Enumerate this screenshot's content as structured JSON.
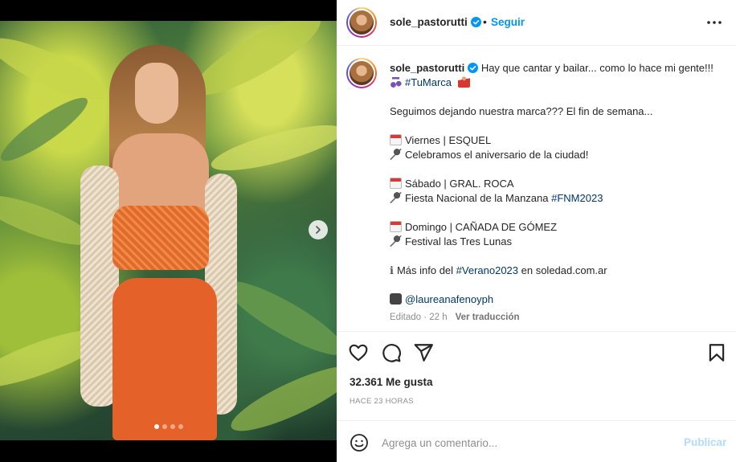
{
  "post": {
    "username": "sole_pastorutti",
    "follow_label": "Seguir",
    "follow_separator": "•",
    "caption": {
      "line1_text": "Hay que cantar y bailar... como lo hace mi gente!!! ",
      "line1_tag": "#TuMarca",
      "line2": "Seguimos dejando nuestra marca??? El fin de semana...",
      "event1_title": "Viernes | ESQUEL",
      "event1_detail": "Celebramos el aniversario de la ciudad!",
      "event2_title": "Sábado | GRAL. ROCA",
      "event2_detail": "Fiesta Nacional de la Manzana ",
      "event2_tag": "#FNM2023",
      "event3_title": "Domingo | CAÑADA DE GÓMEZ",
      "event3_detail": "Festival las Tres Lunas",
      "info_prefix": "Más info del ",
      "info_tag": "#Verano2023",
      "info_suffix": " en soledad.com.ar",
      "photo_credit": "@laureanafenoyph"
    },
    "meta": {
      "edited": "Editado · 22 h",
      "translate": "Ver traducción"
    },
    "likes": "32.361 Me gusta",
    "time_ago": "HACE 23 HORAS",
    "comment": {
      "placeholder": "Agrega un comentario...",
      "publish_label": "Publicar"
    },
    "carousel": {
      "count": 4,
      "active_index": 0
    }
  },
  "icons": {
    "verified": "verified-badge-icon",
    "more": "more-options-icon",
    "like": "heart-icon",
    "comment": "comment-icon",
    "share": "share-icon",
    "save": "bookmark-icon",
    "emoji": "smile-icon",
    "next": "chevron-right-icon"
  },
  "colors": {
    "link_blue": "#0095f6",
    "hashtag": "#00376b",
    "publish_disabled": "#b3dbff"
  }
}
